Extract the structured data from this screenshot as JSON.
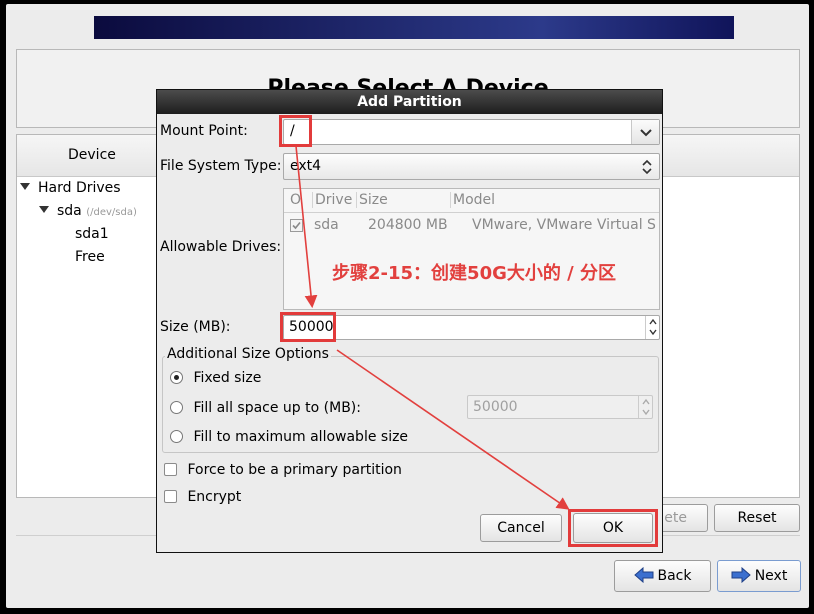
{
  "installer": {
    "page_title": "Please Select A Device",
    "tree_header": "Device",
    "tree": {
      "hard_drives": "Hard Drives",
      "sda": "sda",
      "sda_path": "(/dev/sda)",
      "sda1": "sda1",
      "free": "Free"
    },
    "buttons": {
      "delete": "Delete",
      "reset": "Reset",
      "back": "Back",
      "next": "Next"
    }
  },
  "dialog": {
    "title": "Add Partition",
    "mount_point_label": "Mount Point:",
    "mount_point_value": "/",
    "fs_type_label": "File System Type:",
    "fs_type_value": "ext4",
    "allowable_drives_label": "Allowable Drives:",
    "drives_columns": [
      "O",
      "Drive",
      "Size",
      "Model"
    ],
    "drives_rows": [
      {
        "drive": "sda",
        "size": "204800 MB",
        "model": "VMware, VMware Virtual S"
      }
    ],
    "size_label": "Size (MB):",
    "size_value": "50000",
    "additional_options_label": "Additional Size Options",
    "fixed_size": "Fixed size",
    "fill_up_to": "Fill all space up to (MB):",
    "fill_up_to_value": "50000",
    "fill_max": "Fill to maximum allowable size",
    "force_primary": "Force to be a primary partition",
    "encrypt": "Encrypt",
    "cancel": "Cancel",
    "ok": "OK"
  },
  "annotation": "步骤2-15：创建50G大小的 / 分区",
  "colors": {
    "annotation_red": "#e2403e",
    "banner": "#1a1f6a"
  }
}
